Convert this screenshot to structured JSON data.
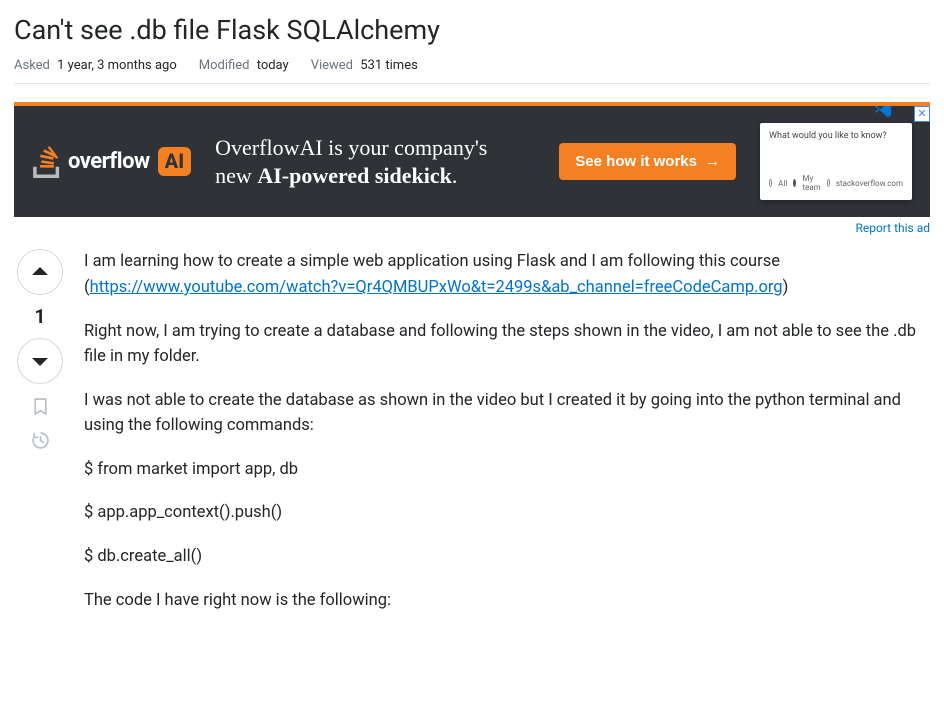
{
  "question": {
    "title": "Can't see .db file Flask SQLAlchemy",
    "meta": {
      "asked_label": "Asked",
      "asked_value": "1 year, 3 months ago",
      "modified_label": "Modified",
      "modified_value": "today",
      "viewed_label": "Viewed",
      "viewed_value": "531 times"
    }
  },
  "ad": {
    "logo_text": "overflow",
    "logo_ai": "AI",
    "copy_line1": "OverflowAI is your company's",
    "copy_line2_prefix": "new ",
    "copy_line2_bold": "AI-powered sidekick",
    "copy_line2_suffix": ".",
    "cta_label": "See how it works",
    "panel_q": "What would you like to know?",
    "panel_opts": [
      "All",
      "My team",
      "stackoverflow.com"
    ],
    "report_label": "Report this ad"
  },
  "vote": {
    "score": "1"
  },
  "body": {
    "p1_prefix": "I am learning how to create a simple web application using Flask and I am following this course (",
    "p1_link": "https://www.youtube.com/watch?v=Qr4QMBUPxWo&t=2499s&ab_channel=freeCodeCamp.org",
    "p1_suffix": ")",
    "p2": "Right now, I am trying to create a database and following the steps shown in the video, I am not able to see the .db file in my folder.",
    "p3": "I was not able to create the database as shown in the video but I created it by going into the python terminal and using the following commands:",
    "cmd1": "$ from market import app, db",
    "cmd2": "$ app.app_context().push()",
    "cmd3": "$ db.create_all()",
    "p4": "The code I have right now is the following:"
  }
}
